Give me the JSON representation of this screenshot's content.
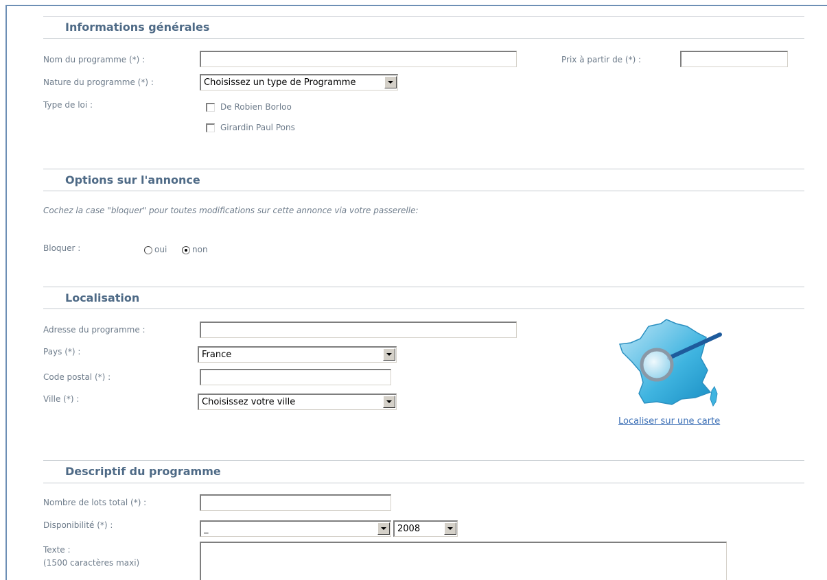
{
  "sections": {
    "general": {
      "title": "Informations générales"
    },
    "options": {
      "title": "Options sur l'annonce"
    },
    "location": {
      "title": "Localisation"
    },
    "description": {
      "title": "Descriptif du programme"
    }
  },
  "general": {
    "program_name_label": "Nom du programme (*) :",
    "program_name_value": "",
    "price_label": "Prix à partir de (*) :",
    "price_value": "",
    "nature_label": "Nature du programme (*) :",
    "nature_selected": "Choisissez un type de Programme",
    "law_type_label": "Type de loi :",
    "law_options": [
      {
        "label": "De Robien Borloo",
        "checked": false
      },
      {
        "label": "Girardin Paul Pons",
        "checked": false
      }
    ]
  },
  "options": {
    "note": "Cochez la case \"bloquer\" pour toutes modifications sur cette annonce via votre passerelle:",
    "block_label": "Bloquer :",
    "yes_label": "oui",
    "no_label": "non",
    "selected": "non"
  },
  "location": {
    "address_label": "Adresse du programme :",
    "address_value": "",
    "country_label": "Pays (*) :",
    "country_selected": "France",
    "postal_code_label": "Code postal (*) :",
    "postal_code_value": "",
    "city_label": "Ville (*) :",
    "city_selected": "Choisissez votre ville",
    "map_link": "Localiser sur une carte",
    "map_icon": "france-map-magnifier-icon"
  },
  "description": {
    "lots_label": "Nombre de lots total (*) :",
    "lots_value": "",
    "availability_label": "Disponibilité (*) :",
    "availability_month_selected": "_",
    "availability_year_selected": "2008",
    "text_label": "Texte :",
    "text_hint": "(1500 caractères maxi)",
    "text_value": ""
  },
  "colors": {
    "section_title": "#4e6a86",
    "label": "#6e7c8b",
    "link": "#3b6fb6",
    "frame": "#6d8fb5"
  }
}
